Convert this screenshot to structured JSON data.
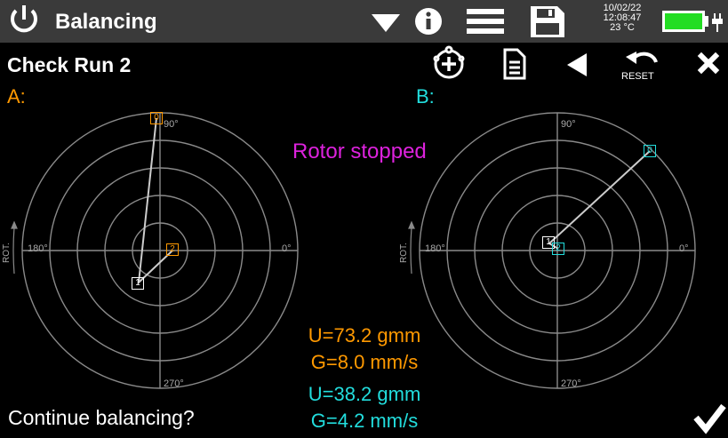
{
  "header": {
    "title": "Balancing",
    "date": "10/02/22",
    "time": "12:08:47",
    "temperature": "23 °C",
    "battery_color": "#22dd22",
    "icons": [
      "power-icon",
      "dropdown-triangle-icon",
      "info-icon",
      "menu-icon",
      "save-icon",
      "battery-icon",
      "plug-icon"
    ]
  },
  "toolbar": {
    "run_title": "Check Run 2",
    "reset_label": "RESET",
    "icons": [
      "add-rotor-icon",
      "document-icon",
      "back-icon",
      "reset-icon",
      "close-icon"
    ]
  },
  "plane_a": {
    "label": "A:",
    "color": "#ff9900",
    "axis_labels": {
      "top": "90°",
      "left": "180°",
      "right": "0°",
      "bottom": "270°",
      "rot": "ROT."
    },
    "markers": [
      "0",
      "1",
      "2"
    ],
    "result_u": "U=73.2 gmm",
    "result_g": "G=8.0 mm/s"
  },
  "plane_b": {
    "label": "B:",
    "color": "#22dddd",
    "axis_labels": {
      "top": "90°",
      "left": "180°",
      "right": "0°",
      "bottom": "270°",
      "rot": "ROT."
    },
    "markers": [
      "0",
      "1",
      "2"
    ],
    "result_u": "U=38.2 gmm",
    "result_g": "G=4.2 mm/s"
  },
  "status": {
    "text": "Rotor stopped",
    "color": "#dd22dd"
  },
  "footer": {
    "prompt": "Continue balancing?"
  }
}
